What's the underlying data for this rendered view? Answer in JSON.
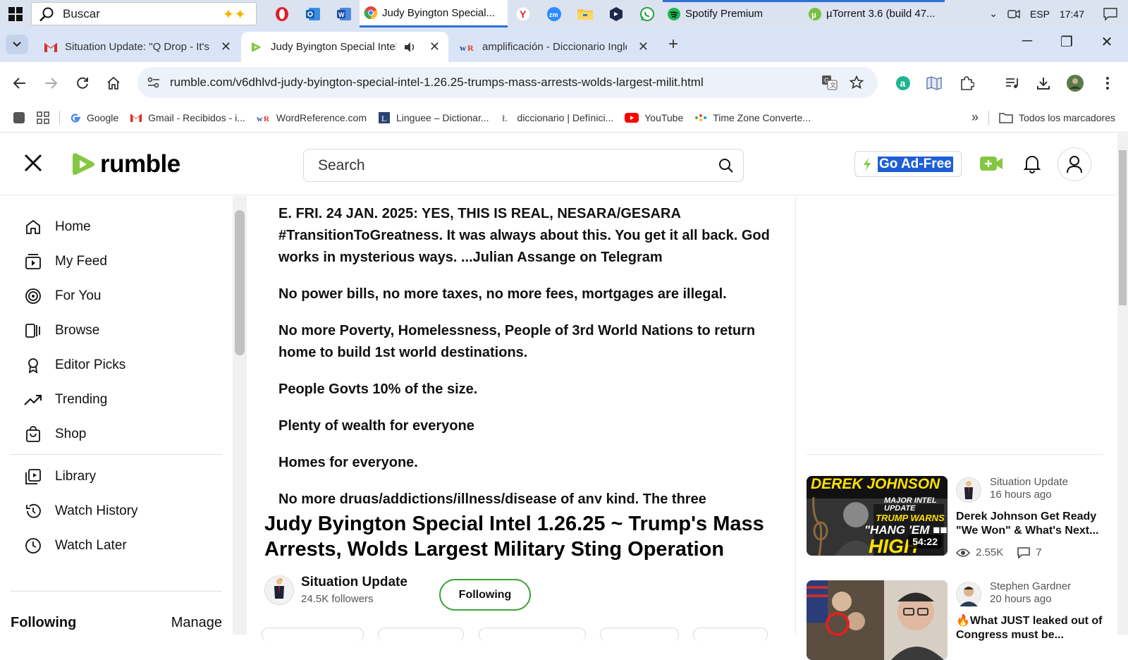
{
  "taskbar": {
    "search_placeholder": "Buscar",
    "apps": [
      {
        "name": "Opera",
        "color": "#e0202a"
      },
      {
        "name": "Outlook",
        "color": "#1a73d6"
      },
      {
        "name": "Word",
        "color": "#2b579a"
      }
    ],
    "active_window": "Judy Byington Special...",
    "window_spotify": "Spotify Premium",
    "window_utorrent": "µTorrent 3.6  (build 47...",
    "tray_lang": "ESP",
    "tray_time": "17:47"
  },
  "tabs": [
    {
      "title": "Situation Update: \"Q Drop - It's",
      "icon": "gmail-icon"
    },
    {
      "title": "Judy Byington Special Intel",
      "icon": "rumble-icon",
      "audio": true
    },
    {
      "title": "amplificación - Diccionario Inglé",
      "icon": "wordreference-icon"
    }
  ],
  "toolbar": {
    "url": "rumble.com/v6dhlvd-judy-byington-special-intel-1.26.25-trumps-mass-arrests-wolds-largest-milit.html"
  },
  "bookmarks": {
    "items": [
      "Google",
      "Gmail - Recibidos - i...",
      "WordReference.com",
      "Linguee – Dictionar...",
      "diccionario | Defínici...",
      "YouTube",
      "Time Zone Converte..."
    ],
    "all_bookmarks": "Todos los marcadores"
  },
  "site": {
    "brand": "rumble",
    "brand_color": "#85c742",
    "search_placeholder": "Search",
    "go_ad_free": "Go Ad-Free"
  },
  "sidebar": {
    "items": [
      {
        "label": "Home",
        "icon": "home-icon"
      },
      {
        "label": "My Feed",
        "icon": "feed-icon"
      },
      {
        "label": "For You",
        "icon": "target-icon"
      },
      {
        "label": "Browse",
        "icon": "browse-icon"
      },
      {
        "label": "Editor Picks",
        "icon": "ribbon-icon"
      },
      {
        "label": "Trending",
        "icon": "trending-icon"
      },
      {
        "label": "Shop",
        "icon": "shop-icon"
      },
      {
        "label": "Library",
        "icon": "library-icon"
      },
      {
        "label": "Watch History",
        "icon": "history-icon"
      },
      {
        "label": "Watch Later",
        "icon": "clock-icon"
      }
    ],
    "following_label": "Following",
    "manage_label": "Manage"
  },
  "description": {
    "paragraphs": [
      "E. FRI. 24 JAN. 2025: YES, THIS IS REAL, NESARA/GESARA #TransitionToGreatness. It was always about this. You get it all back. God works in mysterious ways. ...Julian Assange on Telegram",
      "No power bills, no more taxes, no more fees, mortgages are illegal.",
      "No more Poverty, Homelessness, People of 3rd World Nations to return home to build 1st world destinations.",
      "People Govts 10% of the size.",
      "Plenty of wealth for everyone",
      "Homes for everyone.",
      "No more drugs/addictions/illness/disease of any kind. The three"
    ]
  },
  "video": {
    "title": "Judy Byington Special Intel 1.26.25 ~ Trump's Mass Arrests, Wolds Largest Military Sting Operation",
    "channel_name": "Situation Update",
    "followers": "24.5K followers",
    "follow_state": "Following"
  },
  "related": [
    {
      "channel": "Situation Update",
      "time": "16 hours ago",
      "title": "Derek Johnson Get Ready \"We Won\" & What's Next...",
      "duration": "54:22",
      "views": "2.55K",
      "comments": "7",
      "thumb_text_1": "DEREK JOHNSON",
      "thumb_text_2": "MAJOR INTEL UPDATE",
      "thumb_text_3": "TRUMP WARNS",
      "thumb_text_4": "\"HANG 'EM ■■\"",
      "thumb_text_5": "HIGH"
    },
    {
      "channel": "Stephen Gardner",
      "time": "20 hours ago",
      "title": "🔥What JUST leaked out of Congress must be...",
      "duration": "",
      "views": "",
      "comments": ""
    }
  ]
}
